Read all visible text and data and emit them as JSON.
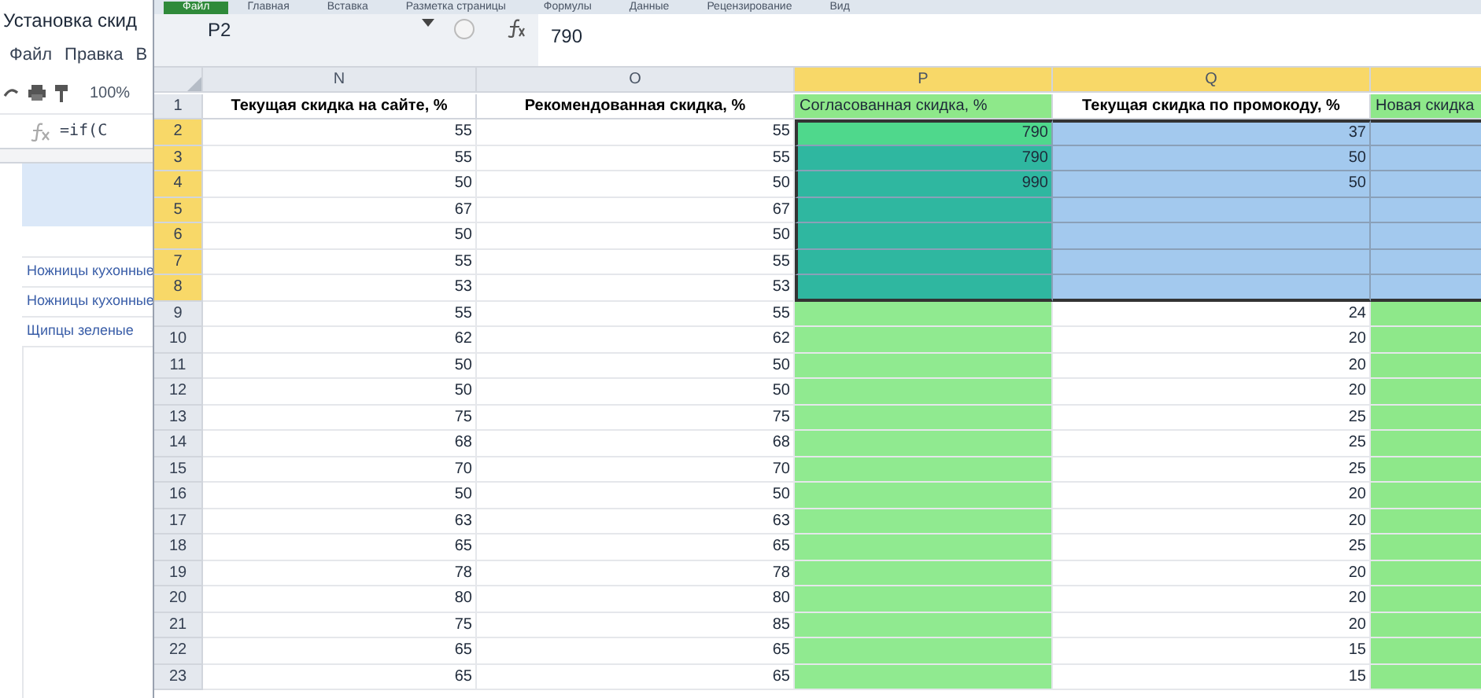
{
  "sheets_window": {
    "title": "Установка скид",
    "menu": [
      "Файл",
      "Правка",
      "В"
    ],
    "zoom": "100%",
    "formula": "=if(C",
    "items": [
      "Ножницы кухонные",
      "Ножницы кухонные",
      "Щипцы зеленые"
    ]
  },
  "excel": {
    "ribbon_tabs": [
      {
        "label": "Файл",
        "selected": true
      },
      {
        "label": "Главная",
        "selected": false
      },
      {
        "label": "Вставка",
        "selected": false
      },
      {
        "label": "Разметка страницы",
        "selected": false
      },
      {
        "label": "Формулы",
        "selected": false
      },
      {
        "label": "Данные",
        "selected": false
      },
      {
        "label": "Рецензирование",
        "selected": false
      },
      {
        "label": "Вид",
        "selected": false
      }
    ],
    "name_box": "P2",
    "formula_value": "790",
    "columns": [
      {
        "letter": "N",
        "title": "Текущая скидка на сайте, %",
        "selected": false
      },
      {
        "letter": "O",
        "title": "Рекомендованная скидка, %",
        "selected": false
      },
      {
        "letter": "P",
        "title": "Согласованная скидка, %",
        "selected": true,
        "color": "#8ee88a"
      },
      {
        "letter": "Q",
        "title": "Текущая скидка по промокоду, %",
        "selected": true
      },
      {
        "title": "Новая скидка",
        "selected": true,
        "color": "#8ee88a"
      }
    ],
    "header_row_number": "1",
    "rows": [
      {
        "number": "2",
        "selected": true,
        "n": "55",
        "o": "55",
        "p": {
          "value": "790",
          "color": "#4fd88c"
        },
        "q": "37"
      },
      {
        "number": "3",
        "selected": true,
        "n": "55",
        "o": "55",
        "p": {
          "value": "790",
          "color": "#2fb7a0"
        },
        "q": "50"
      },
      {
        "number": "4",
        "selected": true,
        "n": "50",
        "o": "50",
        "p": {
          "value": "990",
          "color": "#2fb7a0"
        },
        "q": "50"
      },
      {
        "number": "5",
        "selected": true,
        "n": "67",
        "o": "67",
        "p": {
          "color": "#2fb7a0"
        }
      },
      {
        "number": "6",
        "selected": true,
        "n": "50",
        "o": "50",
        "p": {
          "color": "#2fb7a0"
        }
      },
      {
        "number": "7",
        "selected": true,
        "n": "55",
        "o": "55",
        "p": {
          "color": "#2fb7a0"
        }
      },
      {
        "number": "8",
        "selected": true,
        "n": "53",
        "o": "53",
        "p": {
          "color": "#2fb7a0"
        }
      },
      {
        "number": "9",
        "selected": false,
        "n": "55",
        "o": "55",
        "p": {
          "color": "#90ea90"
        },
        "q": "24"
      },
      {
        "number": "10",
        "selected": false,
        "n": "62",
        "o": "62",
        "p": {
          "color": "#90ea90"
        },
        "q": "20"
      },
      {
        "number": "11",
        "selected": false,
        "n": "50",
        "o": "50",
        "p": {
          "color": "#90ea90"
        },
        "q": "20"
      },
      {
        "number": "12",
        "selected": false,
        "n": "50",
        "o": "50",
        "p": {
          "color": "#90ea90"
        },
        "q": "20"
      },
      {
        "number": "13",
        "selected": false,
        "n": "75",
        "o": "75",
        "p": {
          "color": "#90ea90"
        },
        "q": "25"
      },
      {
        "number": "14",
        "selected": false,
        "n": "68",
        "o": "68",
        "p": {
          "color": "#90ea90"
        },
        "q": "25"
      },
      {
        "number": "15",
        "selected": false,
        "n": "70",
        "o": "70",
        "p": {
          "color": "#90ea90"
        },
        "q": "25"
      },
      {
        "number": "16",
        "selected": false,
        "n": "50",
        "o": "50",
        "p": {
          "color": "#90ea90"
        },
        "q": "20"
      },
      {
        "number": "17",
        "selected": false,
        "n": "63",
        "o": "63",
        "p": {
          "color": "#90ea90"
        },
        "q": "20"
      },
      {
        "number": "18",
        "selected": false,
        "n": "65",
        "o": "65",
        "p": {
          "color": "#90ea90"
        },
        "q": "25"
      },
      {
        "number": "19",
        "selected": false,
        "n": "78",
        "o": "78",
        "p": {
          "color": "#90ea90"
        },
        "q": "20"
      },
      {
        "number": "20",
        "selected": false,
        "n": "80",
        "o": "80",
        "p": {
          "color": "#90ea90"
        },
        "q": "20"
      },
      {
        "number": "21",
        "selected": false,
        "n": "75",
        "o": "85",
        "p": {
          "color": "#90ea90"
        },
        "q": "20"
      },
      {
        "number": "22",
        "selected": false,
        "n": "65",
        "o": "65",
        "p": {
          "color": "#90ea90"
        },
        "q": "15"
      },
      {
        "number": "23",
        "selected": false,
        "n": "65",
        "o": "65",
        "p": {
          "color": "#90ea90"
        },
        "q": "15"
      }
    ]
  }
}
